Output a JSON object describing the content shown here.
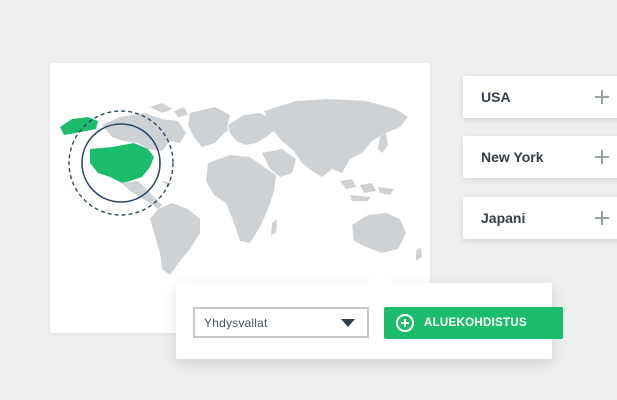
{
  "region_list": [
    {
      "label": "USA"
    },
    {
      "label": "New York"
    },
    {
      "label": "Japani"
    }
  ],
  "targeting": {
    "country_select_value": "Yhdysvallat",
    "button_label": "ALUEKOHDISTUS"
  },
  "map": {
    "selected_region": "United States",
    "land_color": "#cfd2d4",
    "highlight_color": "#1bbd6d",
    "ring_color": "#2b4a66"
  },
  "icons": {
    "add": "plus-icon",
    "dropdown": "caret-down-icon",
    "add_circle": "plus-circle-icon"
  }
}
